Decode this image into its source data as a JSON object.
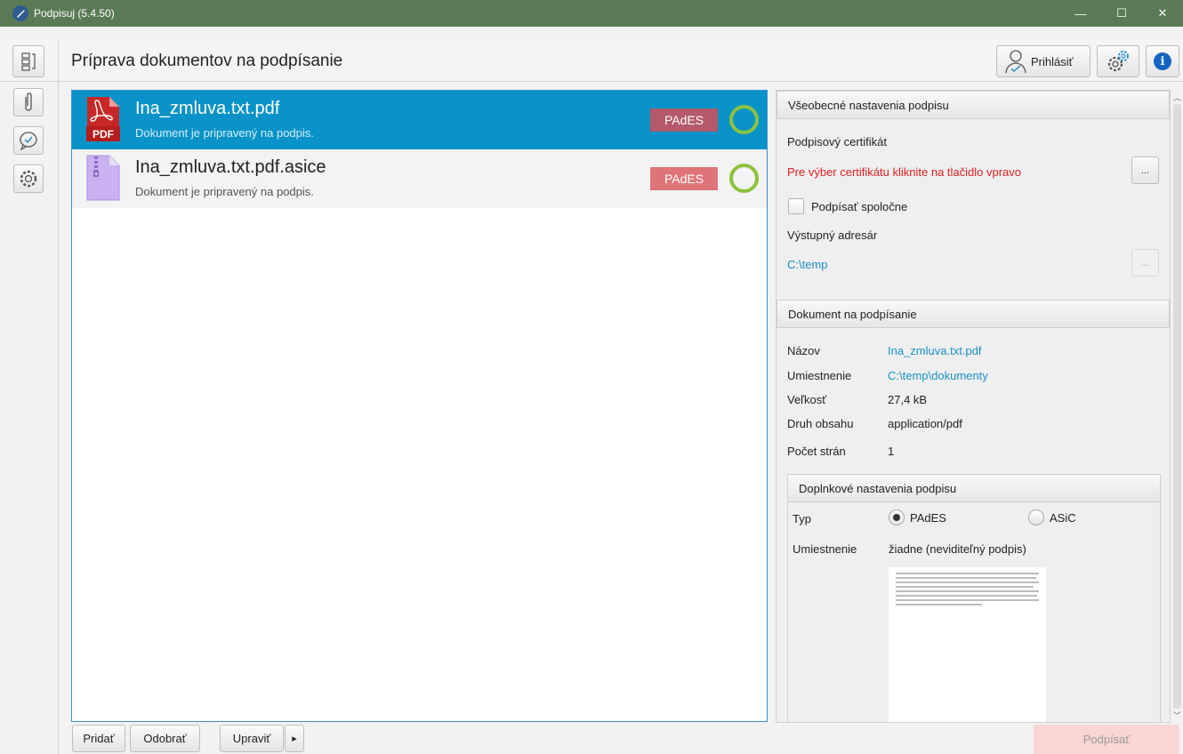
{
  "window": {
    "title": "Podpisuj (5.4.50)",
    "minimize": "—",
    "maximize": "☐",
    "close": "✕"
  },
  "header": {
    "page_title": "Príprava dokumentov na podpísanie",
    "login_label": "Prihlásiť"
  },
  "documents": [
    {
      "name": "Ina_zmluva.txt.pdf",
      "status": "Dokument je pripravený na podpis.",
      "badge": "PAdES",
      "icon": "pdf-icon",
      "icon_text": "PDF",
      "selected": true
    },
    {
      "name": "Ina_zmluva.txt.pdf.asice",
      "status": "Dokument je pripravený na podpis.",
      "badge": "PAdES",
      "icon": "zip-archive-icon",
      "selected": false
    }
  ],
  "bottom": {
    "add_label": "Pridať",
    "remove_label": "Odobrať",
    "edit_label": "Upraviť",
    "more_label": "▸",
    "sign_label": "Podpísať"
  },
  "general_settings": {
    "title": "Všeobecné nastavenia podpisu",
    "cert_label": "Podpisový certifikát",
    "cert_hint": "Pre výber certifikátu kliknite na tlačidlo vpravo",
    "dots": "...",
    "sign_together_label": "Podpísať spoločne",
    "output_dir_label": "Výstupný adresár",
    "output_dir_value": "C:\\temp"
  },
  "document_info": {
    "title": "Dokument na podpísanie",
    "rows": [
      {
        "label": "Názov",
        "value": "Ina_zmluva.txt.pdf"
      },
      {
        "label": "Umiestnenie",
        "value": "C:\\temp\\dokumenty"
      },
      {
        "label": "Veľkosť",
        "value": "27,4 kB"
      },
      {
        "label": "Druh obsahu",
        "value": "application/pdf"
      },
      {
        "label": "Počet strán",
        "value": "1"
      }
    ]
  },
  "extra_settings": {
    "title": "Doplnkové nastavenia podpisu",
    "type_label": "Typ",
    "option_pades": "PAdES",
    "option_asic": "ASiC",
    "selected_option": "PAdES",
    "placement_label": "Umiestnenie",
    "placement_value": "žiadne (neviditeľný podpis)"
  },
  "colors": {
    "titlebar": "#5a7a55",
    "selected_row": "#0a93c8",
    "badge_selected": "#b45a6a",
    "badge": "#de7479",
    "status_ring": "#8cc23f",
    "link": "#1b8fc4",
    "warning": "#e02020",
    "sign_button": "#f8d6d3"
  }
}
